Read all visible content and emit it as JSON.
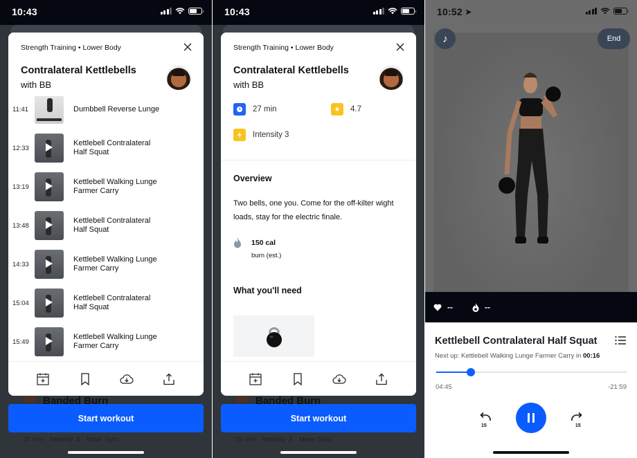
{
  "screens": [
    {
      "status": {
        "time": "10:43"
      },
      "breadcrumb": "Strength Training  •  Lower Body",
      "title": "Contralateral Kettlebells",
      "subtitle": "with BB",
      "exercises": [
        {
          "time": "11:41",
          "name": "Dumbbell Reverse Lunge"
        },
        {
          "time": "12:33",
          "name": "Kettlebell Contralateral Half Squat"
        },
        {
          "time": "13:19",
          "name": "Kettlebell Walking Lunge Farmer Carry"
        },
        {
          "time": "13:48",
          "name": "Kettlebell Contralateral Half Squat"
        },
        {
          "time": "14:33",
          "name": "Kettlebell Walking Lunge Farmer Carry"
        },
        {
          "time": "15:04",
          "name": "Kettlebell Contralateral Half Squat"
        },
        {
          "time": "15:49",
          "name": "Kettlebell Walking Lunge Farmer Carry"
        }
      ],
      "under": {
        "title": "Banded Burn",
        "meta": [
          "25 min",
          "Intensity 3",
          "Move Sync"
        ]
      },
      "start_label": "Start workout"
    },
    {
      "status": {
        "time": "10:43"
      },
      "breadcrumb": "Strength Training  •  Lower Body",
      "title": "Contralateral Kettlebells",
      "subtitle": "with BB",
      "stats": {
        "duration": "27 min",
        "rating": "4.7",
        "intensity": "Intensity 3"
      },
      "overview_title": "Overview",
      "overview_body": "Two bells, one you. Come for the off-kilter wight loads, stay for the electric finale.",
      "calories": {
        "value": "150 cal",
        "label": "burn (est.)"
      },
      "need_title": "What you'll need",
      "equipment": [
        "kettlebell"
      ],
      "under": {
        "title": "Banded Burn",
        "meta": [
          "25 min",
          "Intensity 3",
          "Move Sync"
        ]
      },
      "start_label": "Start workout"
    },
    {
      "status": {
        "time": "10:52"
      },
      "end_label": "End",
      "metrics": {
        "heart_rate": "--",
        "calories": "--"
      },
      "current_exercise": "Kettlebell Contralateral Half Squat",
      "next_up_prefix": "Next up: Kettlebell Walking Lunge Farmer Carry in ",
      "next_up_countdown": "00:16",
      "elapsed": "04:45",
      "remaining": "-21:59",
      "progress_percent": 18,
      "skip_back_seconds": "15",
      "skip_forward_seconds": "15"
    }
  ],
  "icons": {
    "close": "close-icon",
    "calendar": "calendar-add-icon",
    "bookmark": "bookmark-icon",
    "download": "cloud-download-icon",
    "share": "share-icon",
    "music": "music-note-icon",
    "heart": "heart-icon",
    "flame": "flame-icon",
    "list": "list-icon"
  },
  "colors": {
    "accent": "#0b5cff",
    "star_yellow": "#f9c31f",
    "clock_blue": "#2563f0",
    "sheet_backdrop": "#30353c"
  }
}
